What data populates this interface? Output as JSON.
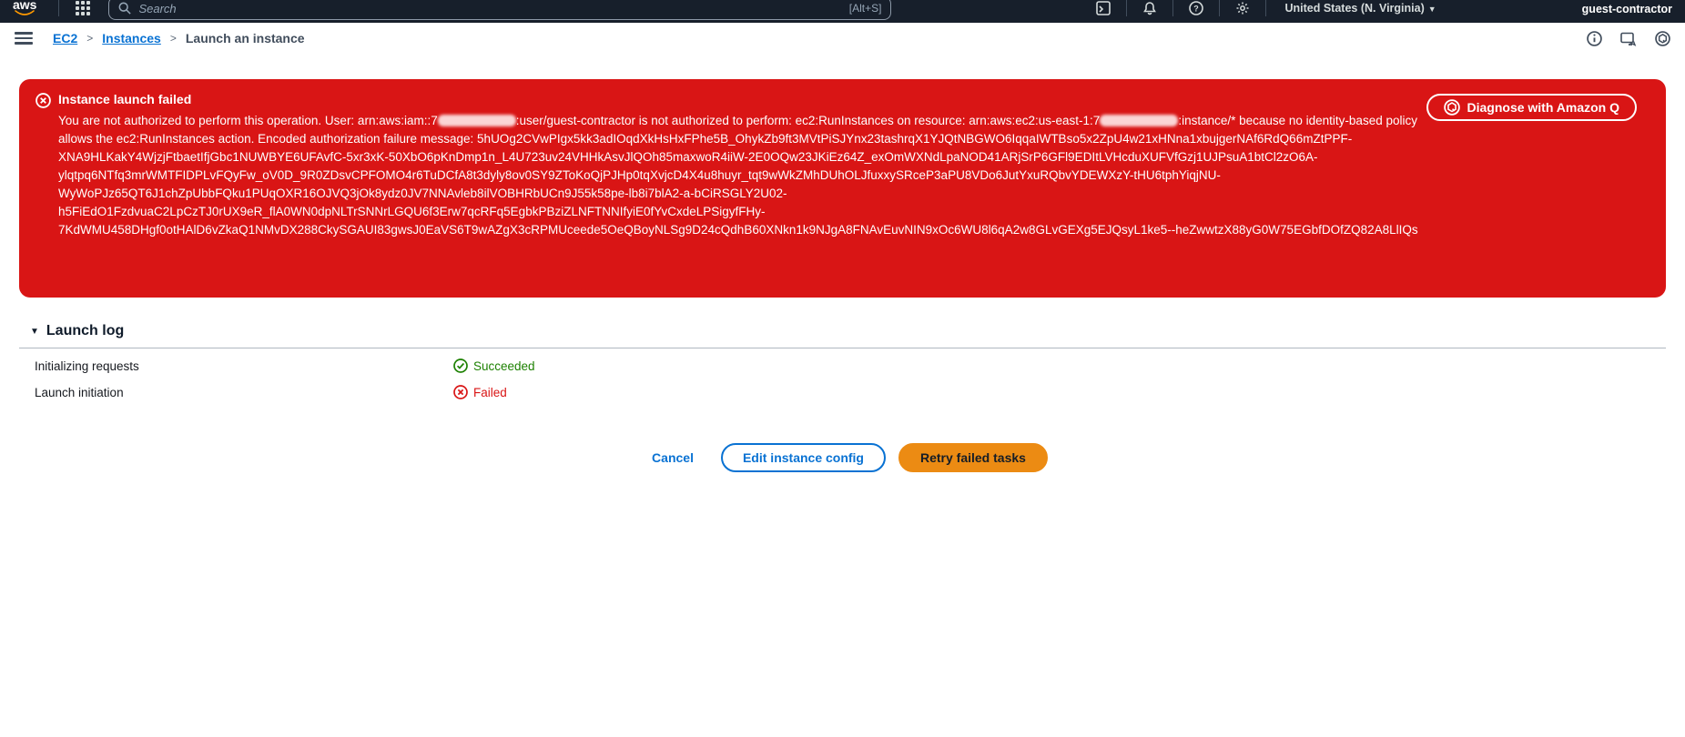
{
  "topbar": {
    "logo": "aws",
    "search": {
      "placeholder": "Search",
      "shortcut": "[Alt+S]"
    },
    "region": "United States (N. Virginia)",
    "account": "guest-contractor",
    "icons": [
      "cloudshell-icon",
      "notifications-bell-icon",
      "help-icon",
      "settings-gear-icon"
    ]
  },
  "breadcrumb": {
    "items": [
      {
        "label": "EC2"
      },
      {
        "label": "Instances"
      },
      {
        "label": "Launch an instance"
      }
    ],
    "right_icons": [
      "info-icon",
      "feedback-icon",
      "amazon-q-icon"
    ]
  },
  "alert": {
    "title": "Instance launch failed",
    "message_part1": "You are not authorized to perform this operation. User: arn:aws:iam::7",
    "message_part2": ":user/guest-contractor is not authorized to perform: ec2:RunInstances on resource: arn:aws:ec2:us-east-1:7",
    "message_part3": ":instance/* because no identity-based policy allows the ec2:RunInstances action. Encoded authorization failure message:",
    "encoded_message": "5hUOg2CVwPIgx5kk3adIOqdXkHsHxFPhe5B_OhykZb9ft3MVtPiSJYnx23tashrqX1YJQtNBGWO6IqqaIWTBso5x2ZpU4w21xHNna1xbujgerNAf6RdQ66mZtPPF-XNA9HLKakY4WjzjFtbaetIfjGbc1NUWBYE6UFAvfC-5xr3xK-50XbO6pKnDmp1n_L4U723uv24VHHkAsvJlQOh85maxwoR4iiW-2E0OQw23JKiEz64Z_exOmWXNdLpaNOD41ARjSrP6GFl9EDItLVHcduXUFVfGzj1UJPsuA1btCl2zO6A-ylqtpq6NTfq3mrWMTFIDPLvFQyFw_oV0D_9R0ZDsvCPFOMO4r6TuDCfA8t3dyly8ov0SY9ZToKoQjPJHp0tqXvjcD4X4u8huyr_tqt9wWkZMhDUhOLJfuxxySRceP3aPU8VDo6JutYxuRQbvYDEWXzY-tHU6tphYiqjNU-WyWoPJz65QT6J1chZpUbbFQku1PUqOXR16OJVQ3jOk8ydz0JV7NNAvleb8ilVOBHRbUCn9J55k58pe-lb8i7blA2-a-bCiRSGLY2U02-h5FiEdO1FzdvuaC2LpCzTJ0rUX9eR_flA0WN0dpNLTrSNNrLGQU6f3Erw7qcRFq5EgbkPBziZLNFTNNIfyiE0fYvCxdeLPSigyfFHy-7KdWMU458DHgf0otHAlD6vZkaQ1NMvDX288CkySGAUI83gwsJ0EaVS6T9wAZgX3cRPMUceede5OeQBoyNLSg9D24cQdhB60XNkn1k9NJgA8FNAvEuvNIN9xOc6WU8l6qA2w8GLvGEXg5EJQsyL1ke5--heZwwtzX88yG0W75EGbfDOfZQ82A8LlIQs",
    "diagnose_button": "Diagnose with Amazon Q",
    "error_icon": "error-circle-x-icon"
  },
  "launch_log": {
    "title": "Launch log",
    "rows": [
      {
        "label": "Initializing requests",
        "status": "Succeeded",
        "state": "success",
        "icon": "success-check-circle-icon"
      },
      {
        "label": "Launch initiation",
        "status": "Failed",
        "state": "error",
        "icon": "error-circle-x-icon"
      }
    ]
  },
  "actions": {
    "cancel": "Cancel",
    "edit": "Edit instance config",
    "retry": "Retry failed tasks"
  },
  "colors": {
    "topbar_bg": "#171f2b",
    "link_blue": "#0972d3",
    "error_red": "#d91515",
    "success_green": "#1d8102",
    "primary_orange": "#ec8b13"
  }
}
